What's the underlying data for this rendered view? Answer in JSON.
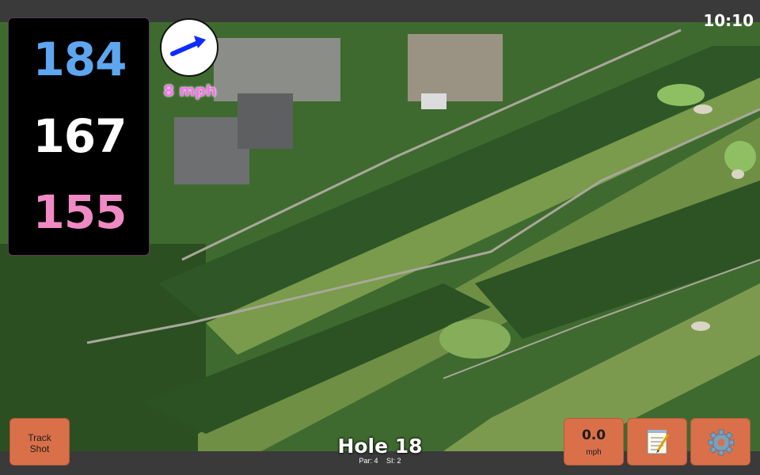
{
  "status": {
    "time": "10:10"
  },
  "distances": {
    "back": "184",
    "center": "167",
    "front": "155"
  },
  "wind": {
    "speed_label": "8 mph"
  },
  "buttons": {
    "track_line1": "Track",
    "track_line2": "Shot",
    "speed_value": "0.0",
    "speed_unit": "mph",
    "notes_icon": "notepad-icon",
    "settings_icon": "gear-icon"
  },
  "hole": {
    "title": "Hole 18",
    "par": "Par: 4",
    "si": "SI: 2"
  },
  "colors": {
    "back_distance": "#5ea6f0",
    "center_distance": "#ffffff",
    "front_distance": "#f08ac4",
    "wind_text": "#fb6ff0",
    "button": "#d9704a"
  }
}
